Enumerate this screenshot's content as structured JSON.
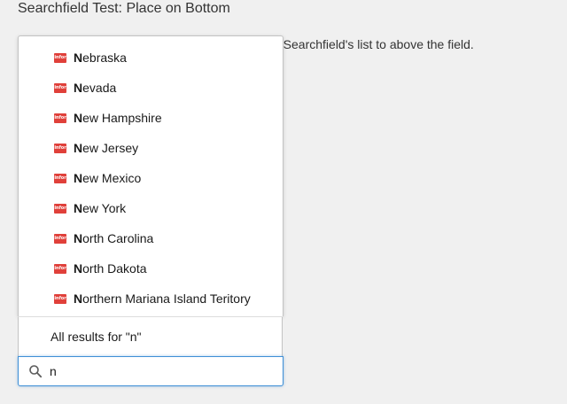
{
  "page": {
    "title": "Searchfield Test: Place on Bottom",
    "description_visible": "e Searchfield's list to above the field."
  },
  "colors": {
    "accent": "#3f8fd6",
    "brand_logo": "#e0403a"
  },
  "searchfield": {
    "value": "n",
    "icon": "search-icon",
    "results": [
      {
        "match": "N",
        "rest": "ebraska",
        "icon_text": "infor"
      },
      {
        "match": "N",
        "rest": "evada",
        "icon_text": "infor"
      },
      {
        "match": "N",
        "rest": "ew Hampshire",
        "icon_text": "infor"
      },
      {
        "match": "N",
        "rest": "ew Jersey",
        "icon_text": "infor"
      },
      {
        "match": "N",
        "rest": "ew Mexico",
        "icon_text": "infor"
      },
      {
        "match": "N",
        "rest": "ew York",
        "icon_text": "infor"
      },
      {
        "match": "N",
        "rest": "orth Carolina",
        "icon_text": "infor"
      },
      {
        "match": "N",
        "rest": "orth Dakota",
        "icon_text": "infor"
      },
      {
        "match": "N",
        "rest": "orthern Mariana Island Teritory",
        "icon_text": "infor"
      }
    ],
    "all_results_label": "All results for \"n\""
  }
}
